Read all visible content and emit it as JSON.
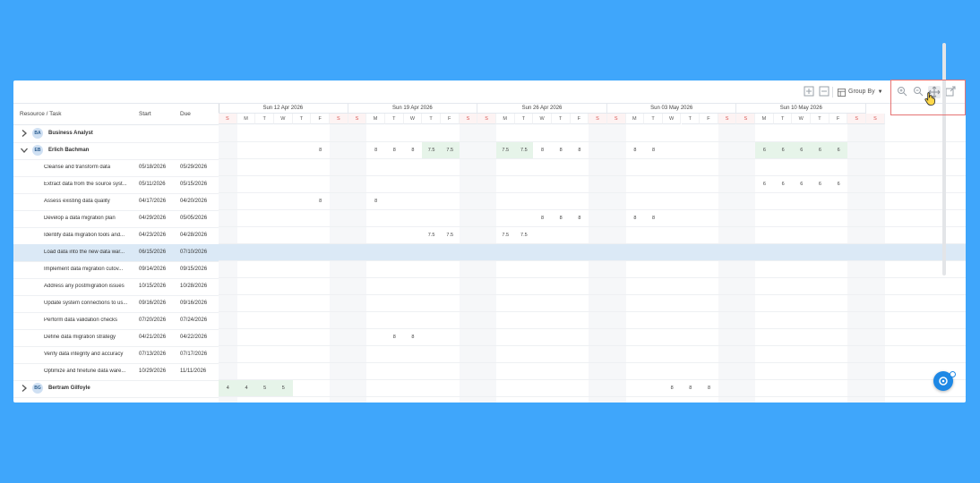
{
  "toolbar": {
    "group_by_label": "Group By"
  },
  "grid_header": {
    "resource_task": "Resource / Task",
    "start": "Start",
    "due": "Due"
  },
  "rows": [
    {
      "type": "resource",
      "initials": "BA",
      "name": "Business Analyst",
      "expanded": false
    },
    {
      "type": "resource",
      "initials": "EB",
      "name": "Erlich Bachman",
      "expanded": true
    },
    {
      "type": "task",
      "name": "Cleanse and transform data",
      "start": "05/18/2026",
      "due": "05/29/2026"
    },
    {
      "type": "task",
      "name": "Extract data from the source syst...",
      "start": "05/11/2026",
      "due": "05/15/2026"
    },
    {
      "type": "task",
      "name": "Assess existing data quality",
      "start": "04/17/2026",
      "due": "04/20/2026"
    },
    {
      "type": "task",
      "name": "Develop a data migration plan",
      "start": "04/29/2026",
      "due": "05/05/2026"
    },
    {
      "type": "task",
      "name": "Identify data migration tools and...",
      "start": "04/23/2026",
      "due": "04/28/2026"
    },
    {
      "type": "task",
      "name": "Load data into the new data war...",
      "start": "06/15/2026",
      "due": "07/10/2026",
      "selected": true
    },
    {
      "type": "task",
      "name": "Implement data migration cutov...",
      "start": "09/14/2026",
      "due": "09/15/2026"
    },
    {
      "type": "task",
      "name": "Address any postmigration issues",
      "start": "10/15/2026",
      "due": "10/28/2026"
    },
    {
      "type": "task",
      "name": "Update system connections to us...",
      "start": "09/16/2026",
      "due": "09/16/2026"
    },
    {
      "type": "task",
      "name": "Perform data validation checks",
      "start": "07/20/2026",
      "due": "07/24/2026"
    },
    {
      "type": "task",
      "name": "Define data migration strategy",
      "start": "04/21/2026",
      "due": "04/22/2026"
    },
    {
      "type": "task",
      "name": "Verify data integrity and accuracy",
      "start": "07/13/2026",
      "due": "07/17/2026"
    },
    {
      "type": "task",
      "name": "Optimize and finetune data ware...",
      "start": "10/29/2026",
      "due": "11/11/2026"
    },
    {
      "type": "resource",
      "initials": "BG",
      "name": "Bertram Gilfoyle",
      "expanded": false
    }
  ],
  "timeline": {
    "weeks": [
      "Sun 12 Apr 2026",
      "Sun 19 Apr 2026",
      "Sun 26 Apr 2026",
      "Sun 03 May 2026",
      "Sun 10 May 2026"
    ],
    "days": [
      "M",
      "T",
      "W",
      "T",
      "F",
      "S",
      "S",
      "M",
      "T",
      "W",
      "T",
      "F",
      "S",
      "S",
      "M",
      "T",
      "W",
      "T",
      "F",
      "S",
      "S",
      "M",
      "T",
      "W",
      "T",
      "F",
      "S",
      "S",
      "M",
      "T",
      "W",
      "T",
      "F",
      "S",
      "S"
    ],
    "lead_days": [
      "M",
      "T",
      "W",
      "T",
      "F",
      "S",
      "S"
    ]
  },
  "hours": [
    {
      "row": 1,
      "cells": [
        {
          "col": 4,
          "v": "8"
        },
        {
          "col": 7,
          "v": "8"
        },
        {
          "col": 8,
          "v": "8"
        },
        {
          "col": 9,
          "v": "8"
        },
        {
          "col": 10,
          "v": "7.5",
          "g": true
        },
        {
          "col": 11,
          "v": "7.5",
          "g": true
        },
        {
          "col": 14,
          "v": "7.5",
          "g": true
        },
        {
          "col": 15,
          "v": "7.5",
          "g": true
        },
        {
          "col": 16,
          "v": "8"
        },
        {
          "col": 17,
          "v": "8"
        },
        {
          "col": 18,
          "v": "8"
        },
        {
          "col": 21,
          "v": "8"
        },
        {
          "col": 22,
          "v": "8"
        },
        {
          "col": 28,
          "v": "6",
          "g": true
        },
        {
          "col": 29,
          "v": "6",
          "g": true
        },
        {
          "col": 30,
          "v": "6",
          "g": true
        },
        {
          "col": 31,
          "v": "6",
          "g": true
        },
        {
          "col": 32,
          "v": "6",
          "g": true
        }
      ]
    },
    {
      "row": 3,
      "cells": [
        {
          "col": 28,
          "v": "6"
        },
        {
          "col": 29,
          "v": "6"
        },
        {
          "col": 30,
          "v": "6"
        },
        {
          "col": 31,
          "v": "6"
        },
        {
          "col": 32,
          "v": "6"
        }
      ]
    },
    {
      "row": 4,
      "cells": [
        {
          "col": 4,
          "v": "8"
        },
        {
          "col": 7,
          "v": "8"
        }
      ]
    },
    {
      "row": 5,
      "cells": [
        {
          "col": 16,
          "v": "8"
        },
        {
          "col": 17,
          "v": "8"
        },
        {
          "col": 18,
          "v": "8"
        },
        {
          "col": 21,
          "v": "8"
        },
        {
          "col": 22,
          "v": "8"
        }
      ]
    },
    {
      "row": 6,
      "cells": [
        {
          "col": 10,
          "v": "7.5"
        },
        {
          "col": 11,
          "v": "7.5"
        },
        {
          "col": 14,
          "v": "7.5"
        },
        {
          "col": 15,
          "v": "7.5"
        }
      ]
    },
    {
      "row": 12,
      "cells": [
        {
          "col": 8,
          "v": "8"
        },
        {
          "col": 9,
          "v": "8"
        }
      ]
    },
    {
      "row": 15,
      "cells": [
        {
          "col": -1,
          "v": "4",
          "g": true
        },
        {
          "col": 0,
          "v": "4",
          "g": true
        },
        {
          "col": 1,
          "v": "5",
          "g": true
        },
        {
          "col": 2,
          "v": "5",
          "g": true
        },
        {
          "col": 23,
          "v": "8"
        },
        {
          "col": 24,
          "v": "8"
        },
        {
          "col": 25,
          "v": "8"
        }
      ]
    }
  ]
}
